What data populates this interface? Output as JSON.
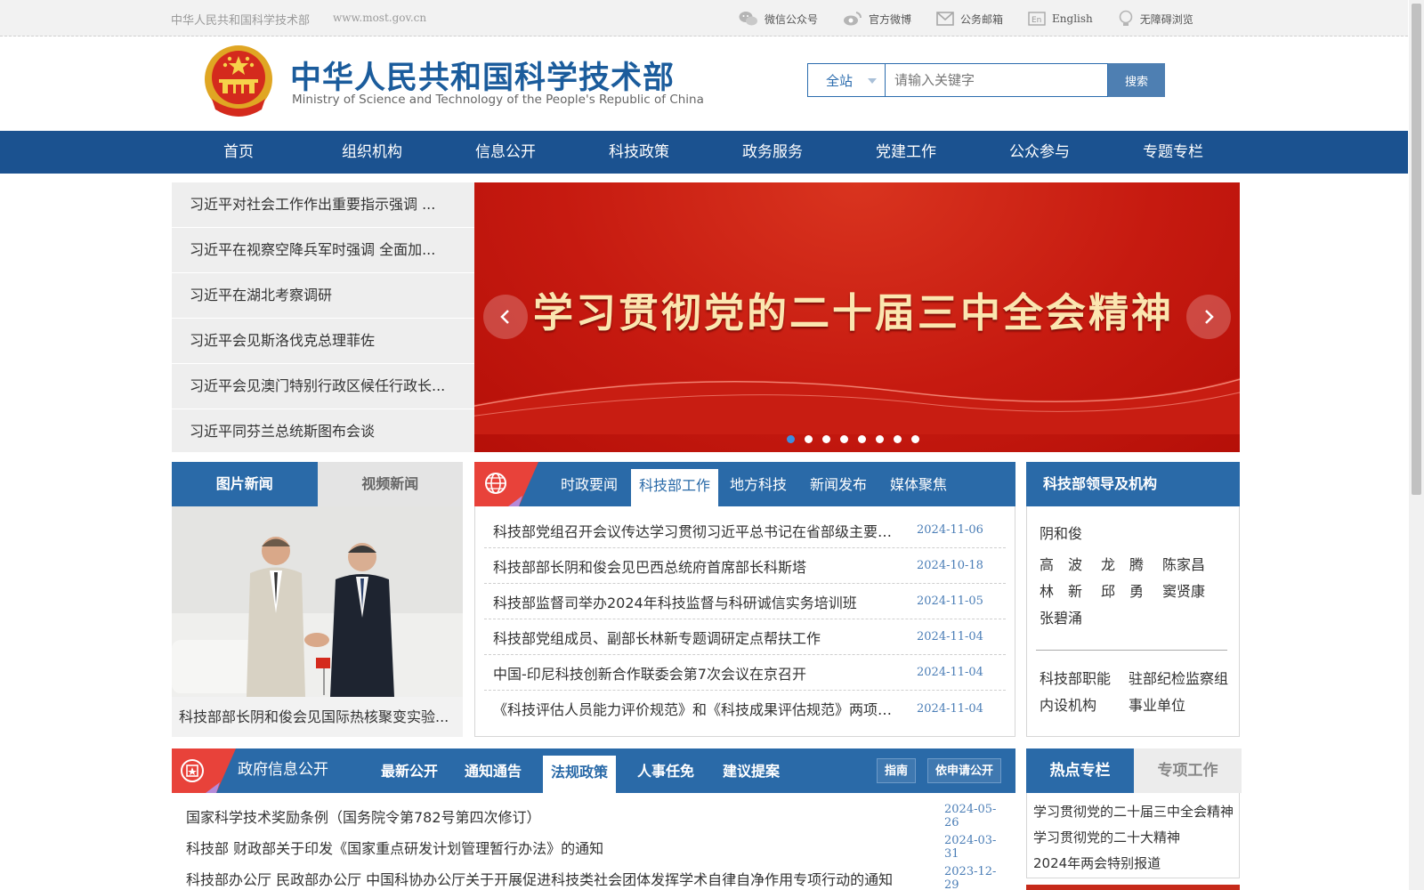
{
  "topbar": {
    "site_name": "中华人民共和国科学技术部",
    "url": "www.most.gov.cn",
    "links": [
      {
        "label": "微信公众号",
        "icon": "wechat-icon"
      },
      {
        "label": "官方微博",
        "icon": "weibo-icon"
      },
      {
        "label": "公务邮箱",
        "icon": "mail-icon"
      },
      {
        "label": "English",
        "icon": "en-icon"
      },
      {
        "label": "无障碍浏览",
        "icon": "bulb-icon"
      }
    ]
  },
  "header": {
    "title_cn": "中华人民共和国科学技术部",
    "title_en": "Ministry of Science and Technology of the People's Republic of China",
    "search": {
      "scope": "全站",
      "placeholder": "请输入关键字",
      "button": "搜索"
    }
  },
  "nav": [
    "首页",
    "组织机构",
    "信息公开",
    "科技政策",
    "政务服务",
    "党建工作",
    "公众参与",
    "专题专栏"
  ],
  "headlines": [
    "习近平对社会工作作出重要指示强调 ...",
    "习近平在视察空降兵军时强调 全面加...",
    "习近平在湖北考察调研",
    "习近平会见斯洛伐克总理菲佐",
    "习近平会见澳门特别行政区候任行政长...",
    "习近平同芬兰总统斯图布会谈"
  ],
  "banner": {
    "slogan": "学习贯彻党的二十届三中全会精神",
    "slide_count": 8,
    "active_slide": 1
  },
  "photo_news": {
    "tabs": [
      "图片新闻",
      "视频新闻"
    ],
    "caption": "科技部部长阴和俊会见国际热核聚变实验..."
  },
  "news": {
    "tabs": [
      "时政要闻",
      "科技部工作",
      "地方科技",
      "新闻发布",
      "媒体聚焦"
    ],
    "active_tab": "科技部工作",
    "items": [
      {
        "title": "科技部党组召开会议传达学习贯彻习近平总书记在省部级主要领导干部学习贯彻党的二十届三中全会精神专题研讨班开班式上的重要讲话精神",
        "date": "2024-11-06"
      },
      {
        "title": "科技部部长阴和俊会见巴西总统府首席部长科斯塔",
        "date": "2024-10-18"
      },
      {
        "title": "科技部监督司举办2024年科技监督与科研诚信实务培训班",
        "date": "2024-11-05"
      },
      {
        "title": "科技部党组成员、副部长林新专题调研定点帮扶工作",
        "date": "2024-11-04"
      },
      {
        "title": "中国-印尼科技创新合作联委会第7次会议在京召开",
        "date": "2024-11-04"
      },
      {
        "title": "《科技评估人员能力评价规范》和《科技成果评估规范》两项国家标准发布",
        "date": "2024-11-04"
      }
    ]
  },
  "leaders": {
    "title": "科技部领导及机构",
    "minister": "阴和俊",
    "rows": [
      [
        "高　波",
        "龙　腾",
        "陈家昌"
      ],
      [
        "林　新",
        "邱　勇",
        "窦贤康"
      ],
      [
        "张碧涌"
      ]
    ],
    "links": [
      [
        "科技部职能",
        "驻部纪检监察组"
      ],
      [
        "内设机构",
        "事业单位"
      ]
    ]
  },
  "gov_info": {
    "title": "政府信息公开",
    "tabs": [
      "最新公开",
      "通知通告",
      "法规政策",
      "人事任免",
      "建议提案"
    ],
    "active_tab": "法规政策",
    "buttons": [
      "指南",
      "依申请公开"
    ],
    "items": [
      {
        "title": "国家科学技术奖励条例（国务院令第782号第四次修订）",
        "date": "2024-05-26"
      },
      {
        "title": "科技部 财政部关于印发《国家重点研发计划管理暂行办法》的通知",
        "date": "2024-03-31"
      },
      {
        "title": "科技部办公厅 民政部办公厅 中国科协办公厅关于开展促进科技类社会团体发挥学术自律自净作用专项行动的通知",
        "date": "2023-12-29"
      }
    ]
  },
  "hot": {
    "tabs": [
      "热点专栏",
      "专项工作"
    ],
    "items": [
      "学习贯彻党的二十届三中全会精神",
      "学习贯彻党的二十大精神",
      "2024年两会特别报道"
    ]
  },
  "colors": {
    "nav": "#1b5290",
    "panel_head": "#2a6aa8",
    "accent_red": "#d82a2a"
  }
}
